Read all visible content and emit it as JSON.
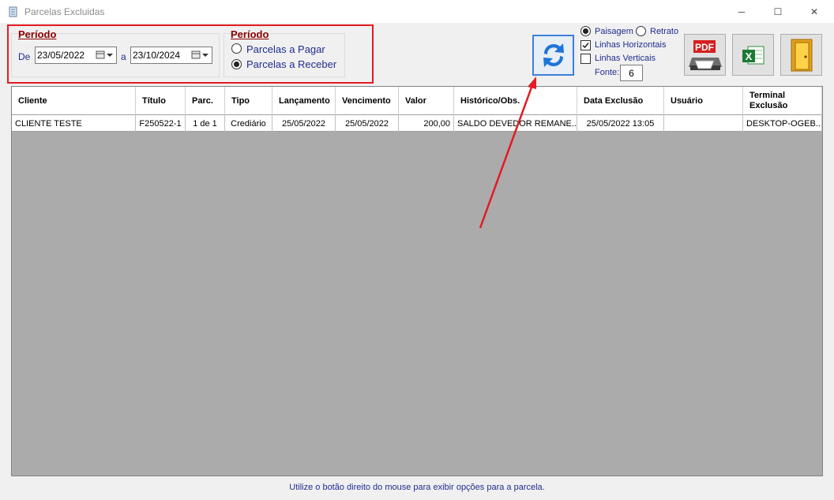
{
  "window": {
    "title": "Parcelas Excluidas",
    "minimize_glyph": "─",
    "maximize_glyph": "☐",
    "close_glyph": "✕"
  },
  "periodo_datas": {
    "title": "Período",
    "de_label": "De",
    "de_value": "23/05/2022",
    "a_label": "a",
    "a_value": "23/10/2024"
  },
  "periodo_tipo": {
    "title": "Período",
    "options": [
      {
        "label": "Parcelas a Pagar",
        "selected": false
      },
      {
        "label": "Parcelas a Receber",
        "selected": true
      }
    ]
  },
  "print_options": {
    "paisagem_label": "Paisagem",
    "paisagem_selected": true,
    "retrato_label": "Retrato",
    "retrato_selected": false,
    "linhas_horizontais_label": "Linhas Horizontais",
    "linhas_horizontais_checked": true,
    "linhas_verticais_label": "Linhas Verticais",
    "linhas_verticais_checked": false,
    "fonte_label": "Fonte:",
    "fonte_value": "6"
  },
  "toolbar": {
    "refresh_icon": "refresh-icon",
    "pdf_label": "PDF",
    "excel_icon": "excel-icon",
    "exit_icon": "exit-door-icon"
  },
  "grid": {
    "columns": [
      {
        "label": "Cliente"
      },
      {
        "label": "Título"
      },
      {
        "label": "Parc."
      },
      {
        "label": "Tipo"
      },
      {
        "label": "Lançamento"
      },
      {
        "label": "Vencimento"
      },
      {
        "label": "Valor"
      },
      {
        "label": "Histórico/Obs."
      },
      {
        "label": "Data Exclusão"
      },
      {
        "label": "Usuário"
      },
      {
        "label": "Terminal Exclusão"
      }
    ],
    "rows": [
      {
        "cliente": "CLIENTE TESTE",
        "titulo": "F250522-1",
        "parc": "1 de 1",
        "tipo": "Crediário",
        "lancamento": "25/05/2022",
        "vencimento": "25/05/2022",
        "valor": "200,00",
        "historico": "SALDO DEVEDOR REMANE...",
        "data_exclusao": "25/05/2022 13:05",
        "usuario": "",
        "terminal": "DESKTOP-OGEB..."
      }
    ]
  },
  "status": {
    "hint": "Utilize o botão direito do mouse para exibir opções para a parcela."
  },
  "colors": {
    "highlight_box": "#e31b23",
    "annotation_arrow": "#e31b23",
    "group_title": "#8b0000",
    "label_navy": "#1f2d8f",
    "grid_empty": "#ababab"
  }
}
